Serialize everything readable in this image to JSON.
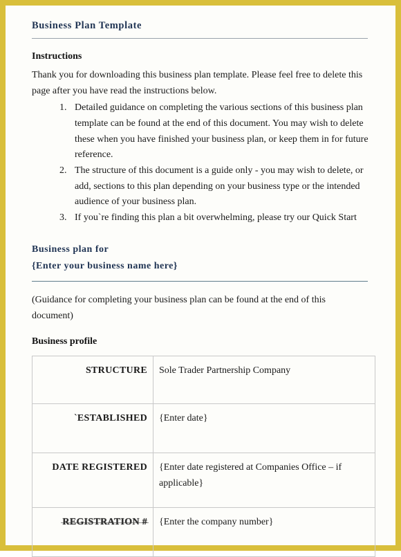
{
  "document": {
    "title": "Business Plan Template",
    "instructions_heading": "Instructions",
    "intro_paragraph": "Thank you for downloading this business plan template. Please feel free to delete this page after you have read the instructions below.",
    "instruction_items": [
      "Detailed guidance on completing the various sections of this business plan template can be found at the end of this document. You may wish to delete these when you have finished your business plan, or keep them in for future reference.",
      "The structure of this document is a guide only - you may wish to delete, or add, sections to this plan depending on your business type or the intended audience of your business plan.",
      "If you`re finding this plan a bit overwhelming, please try our Quick Start"
    ],
    "business_plan_for_label": "Business plan for",
    "business_name_placeholder": "{Enter your business name here}",
    "guidance_note": "(Guidance for completing your business plan can be found at the end of this document)",
    "business_profile_heading": "Business profile"
  },
  "profile_table": {
    "rows": [
      {
        "label": "STRUCTURE",
        "value": "Sole Trader Partnership  Company"
      },
      {
        "label": "`ESTABLISHED",
        "value": "{Enter date}"
      },
      {
        "label": "DATE REGISTERED",
        "value": "{Enter date registered at Companies Office – if applicable}"
      },
      {
        "label": "REGISTRATION #",
        "value": "{Enter the company number}"
      }
    ]
  },
  "theme": {
    "border_gold": "#d9bf3b",
    "heading_navy": "#1f3353",
    "rule_gray": "#9aa3ab",
    "rule_blue": "#5f7d8c",
    "page_background": "#fdfdfa",
    "table_border": "#c8c8c8"
  }
}
